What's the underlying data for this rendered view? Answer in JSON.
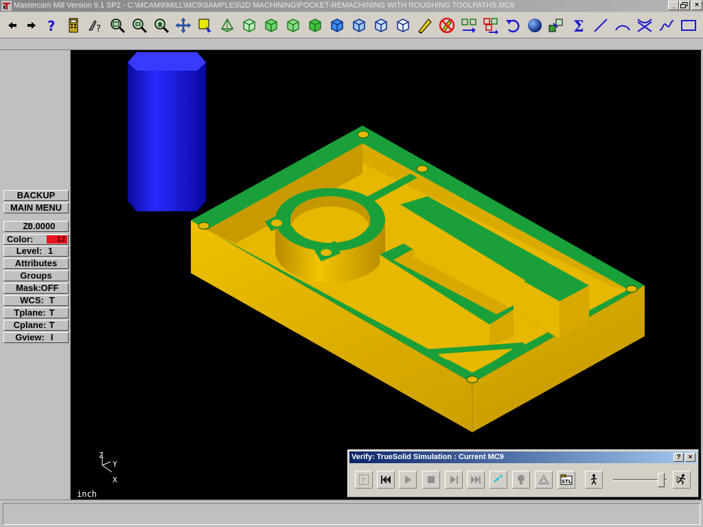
{
  "window": {
    "title": "Mastercam Mill Version 9.1 SP2 - C:\\MCAM9\\MILL\\MC9\\SAMPLES\\2D MACHINING\\POCKET-REMACHINING WITH ROUGHING TOOLPATHS.MC9",
    "minimize_icon": "minimize-icon",
    "restore_icon": "restore-icon",
    "close_icon": "close-icon"
  },
  "toolbar": {
    "buttons": [
      {
        "icon": "arrow-left-icon"
      },
      {
        "icon": "arrow-right-icon"
      },
      {
        "icon": "help-icon"
      },
      {
        "icon": "calculator-icon"
      },
      {
        "icon": "analyze-icon"
      },
      {
        "icon": "zoom-window-icon"
      },
      {
        "icon": "unzoom-icon"
      },
      {
        "icon": "zoom-8-icon"
      },
      {
        "icon": "pan-icon"
      },
      {
        "icon": "gview-select-icon"
      },
      {
        "icon": "gview-dynamic-icon"
      },
      {
        "icon": "view-top-icon"
      },
      {
        "icon": "view-front-icon"
      },
      {
        "icon": "view-side-icon"
      },
      {
        "icon": "view-iso-icon"
      },
      {
        "icon": "cplane-top-icon"
      },
      {
        "icon": "cplane-front-icon"
      },
      {
        "icon": "cplane-side-icon"
      },
      {
        "icon": "cplane-3d-icon"
      },
      {
        "icon": "screen-clear-icon"
      },
      {
        "icon": "no-delete-icon"
      },
      {
        "icon": "move-icon"
      },
      {
        "icon": "copy-icon"
      },
      {
        "icon": "undo-icon"
      },
      {
        "icon": "shade-icon"
      },
      {
        "icon": "group-icon"
      },
      {
        "icon": "sum-icon"
      },
      {
        "icon": "line-icon"
      },
      {
        "icon": "arc-icon"
      },
      {
        "icon": "trim-icon"
      },
      {
        "icon": "spline-icon"
      },
      {
        "icon": "rectangle-icon"
      }
    ]
  },
  "left_menu": {
    "backup": "BACKUP",
    "main_menu": "MAIN MENU",
    "z_label": "Z:",
    "z_value": "0.0000",
    "color_label": "Color:",
    "color_value": "12",
    "color_hex": "#e8141b",
    "level_label": "Level:",
    "level_value": "1",
    "attributes": "Attributes",
    "groups": "Groups",
    "mask_label": "Mask:",
    "mask_value": "OFF",
    "wcs_label": "WCS:",
    "wcs_value": "T",
    "tplane_label": "Tplane:",
    "tplane_value": "T",
    "cplane_label": "Cplane:",
    "cplane_value": "T",
    "gview_label": "Gview:",
    "gview_value": "I"
  },
  "viewport": {
    "units": "inch",
    "axis_z": "Z",
    "axis_y": "Y",
    "axis_x": "X",
    "part_color": "#e6b800",
    "face_color": "#1aa03a",
    "tool_color": "#1e1ee6"
  },
  "verify": {
    "title": "Verify: TrueSolid Simulation : Current MC9",
    "help": "?",
    "close": "×",
    "controls": [
      "settings-icon",
      "rewind-icon",
      "play-icon",
      "stop-icon",
      "step-icon",
      "fast-forward-icon",
      "cutter-display-icon",
      "light-icon",
      "compare-icon",
      "stl-export-icon",
      "speed-slow-icon",
      "speed-fast-icon"
    ],
    "speed_level": 0.95
  }
}
